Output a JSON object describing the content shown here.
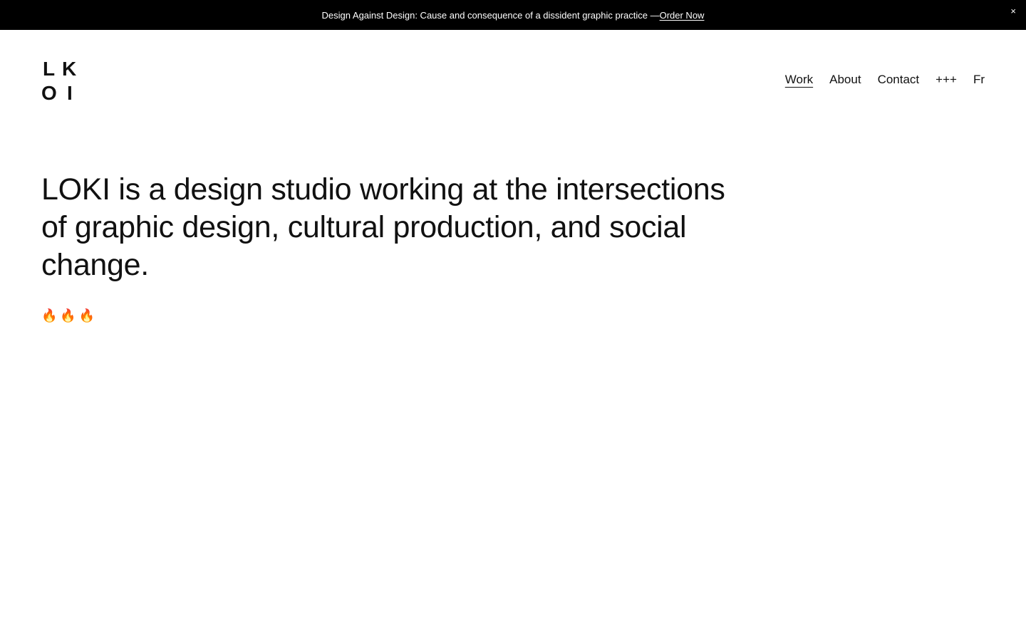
{
  "banner": {
    "text": "Design Against Design: Cause and consequence of a dissident graphic practice — ",
    "link_label": "Order Now",
    "close_icon": "×"
  },
  "logo": {
    "letters": [
      "L",
      "K",
      "O",
      "I"
    ]
  },
  "nav": {
    "items": [
      {
        "label": "Work",
        "active": true
      },
      {
        "label": "About",
        "active": false
      },
      {
        "label": "Contact",
        "active": false
      },
      {
        "label": "+++",
        "active": false
      },
      {
        "label": "Fr",
        "active": false
      }
    ]
  },
  "hero": {
    "intro": "LOKI is a design studio working at the intersections of graphic design, cultural production, and social change.",
    "emoji": "🔥🔥🔥"
  },
  "colors": {
    "banner_bg": "#000000",
    "banner_text": "#ffffff",
    "text": "#111111",
    "background": "#ffffff"
  }
}
